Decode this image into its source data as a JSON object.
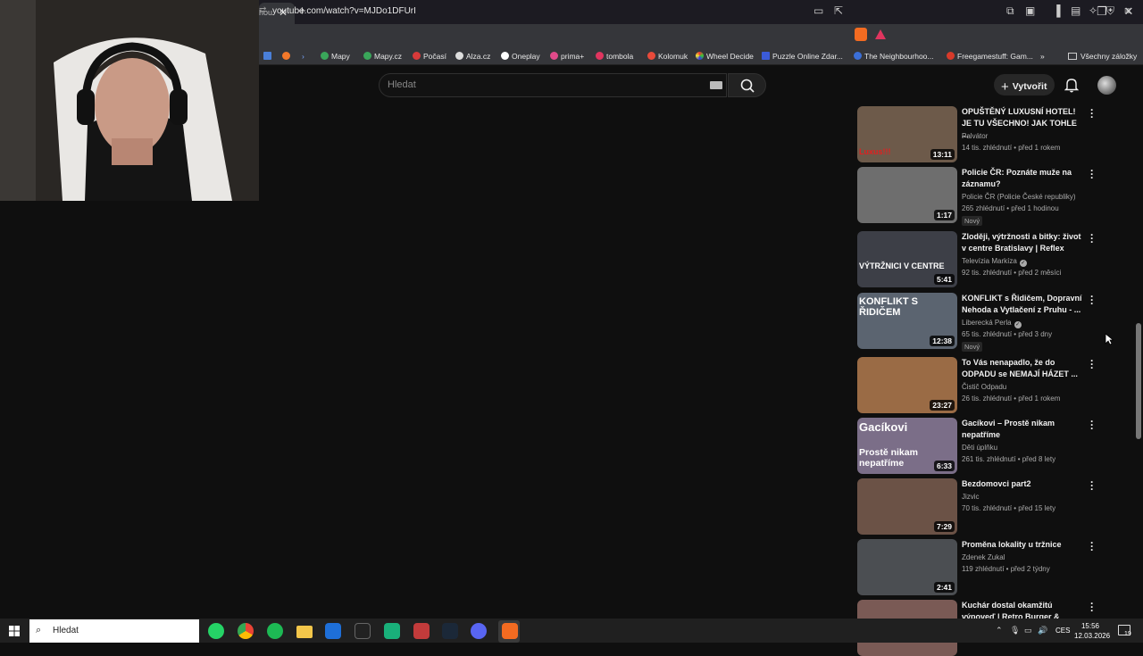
{
  "browser": {
    "tab_title": "hou",
    "url": "youtube.com/watch?v=MJDo1DFUrI",
    "bookmarks": [
      "Mapy",
      "Mapy.cz",
      "Počasí",
      "Alza.cz",
      "Oneplay",
      "prima+",
      "tombola",
      "Kolomuk",
      "Wheel Decide",
      "Puzzle Online Zdar...",
      "The Neighbourhoo...",
      "Freegamestuff: Gam..."
    ],
    "all_bookmarks": "Všechny záložky"
  },
  "youtube": {
    "search_placeholder": "Hledat",
    "create_label": "Vytvořit",
    "videos": [
      {
        "title": "OPUŠTĚNÝ LUXUSNÍ HOTEL! JE TU VŠECHNO! JAK TOHLE ...",
        "channel": "Palvátor",
        "meta": "14 tis. zhlédnutí • před 1 rokem",
        "duration": "13:11",
        "thumb_text": "Luxus!!!",
        "badge": "",
        "verified": false,
        "thumb_color": "#6d5a4a"
      },
      {
        "title": "Policie ČR: Poznáte muže na záznamu?",
        "channel": "Policie ČR (Policie České republiky)",
        "meta": "265 zhlédnutí • před 1 hodinou",
        "duration": "1:17",
        "thumb_text": "",
        "badge": "Nový",
        "verified": false,
        "thumb_color": "#6e6e6e"
      },
      {
        "title": "Zloději, výtržnosti a bitky: život v centre Bratislavy | Reflex",
        "channel": "Televízia Markíza",
        "meta": "92 tis. zhlédnutí • před 2 měsíci",
        "duration": "5:41",
        "thumb_text": "VÝTRŽNICI V CENTRE",
        "badge": "",
        "verified": true,
        "thumb_color": "#3d3f47"
      },
      {
        "title": "KONFLIKT s Řidičem, Dopravní Nehoda a Vytlačení z Pruhu - ...",
        "channel": "Liberecká Perla",
        "meta": "65 tis. zhlédnutí • před 3 dny",
        "duration": "12:38",
        "thumb_text": "KONFLIKT S ŘIDIČEM",
        "badge": "Nový",
        "verified": true,
        "thumb_color": "#5b6470"
      },
      {
        "title": "To Vás nenapadlo, že do ODPADU se NEMAJÍ HÁZET ...",
        "channel": "Čistič Odpadu",
        "meta": "26 tis. zhlédnutí • před 1 rokem",
        "duration": "23:27",
        "thumb_text": "",
        "badge": "",
        "verified": false,
        "thumb_color": "#9a6b45"
      },
      {
        "title": "Gacíkovi – Prostě nikam nepatříme",
        "channel": "Děti úplňku",
        "meta": "261 tis. zhlédnutí • před 8 lety",
        "duration": "6:33",
        "thumb_text": "Gacíkovi",
        "thumb_text2": "Prostě nikam nepatříme",
        "badge": "",
        "verified": false,
        "thumb_color": "#7b6e88"
      },
      {
        "title": "Bezdomovci part2",
        "channel": "Jizvic",
        "meta": "70 tis. zhlédnutí • před 15 lety",
        "duration": "7:29",
        "thumb_text": "",
        "badge": "",
        "verified": false,
        "thumb_color": "#6b5246"
      },
      {
        "title": "Proměna lokality u tržnice",
        "channel": "Zdenek Zukal",
        "meta": "119 zhlédnutí • před 2 týdny",
        "duration": "2:41",
        "thumb_text": "",
        "badge": "",
        "verified": false,
        "thumb_color": "#4b4e52"
      },
      {
        "title": "Kuchár dostal okamžitú výpoveď | Retro Burger & Dinn...",
        "channel": "",
        "meta": "",
        "duration": "",
        "thumb_text": "",
        "badge": "",
        "verified": false,
        "thumb_color": "#7a5a55"
      }
    ]
  },
  "taskbar": {
    "search_placeholder": "Hledat",
    "language": "CES",
    "time": "15:56",
    "date": "12.03.2026",
    "notification_count": "19"
  }
}
